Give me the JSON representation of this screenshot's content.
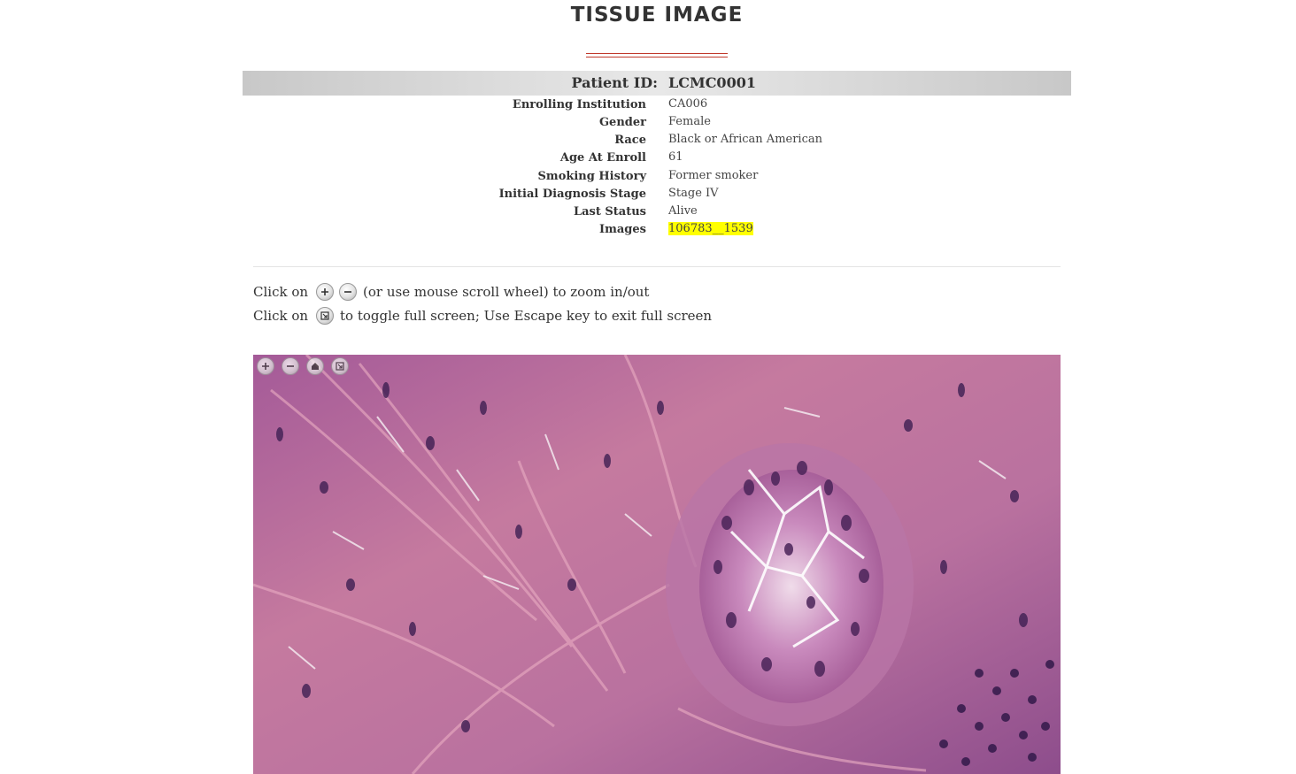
{
  "page": {
    "title": "TISSUE IMAGE"
  },
  "patient": {
    "id_label": "Patient ID:",
    "id_value": "LCMC0001",
    "fields": [
      {
        "label": "Enrolling Institution",
        "value": "CA006"
      },
      {
        "label": "Gender",
        "value": "Female"
      },
      {
        "label": "Race",
        "value": "Black or African American"
      },
      {
        "label": "Age At Enroll",
        "value": "61"
      },
      {
        "label": "Smoking History",
        "value": "Former smoker"
      },
      {
        "label": "Initial Diagnosis Stage",
        "value": "Stage IV"
      },
      {
        "label": "Last Status",
        "value": "Alive"
      },
      {
        "label": "Images",
        "value": "106783__1539"
      }
    ]
  },
  "instructions": {
    "line1_prefix": "Click on",
    "line1_suffix": "(or use mouse scroll wheel) to zoom in/out",
    "line2_prefix": "Click on",
    "line2_suffix": "to toggle full screen; Use Escape key to exit full screen"
  },
  "icons": {
    "zoom_in": "zoom-in-icon",
    "zoom_out": "zoom-out-icon",
    "home": "home-icon",
    "fullscreen": "fullscreen-icon"
  },
  "colors": {
    "accent_rule": "#c0392b",
    "highlight": "#ffff00",
    "tissue_base": "#b2659f"
  }
}
